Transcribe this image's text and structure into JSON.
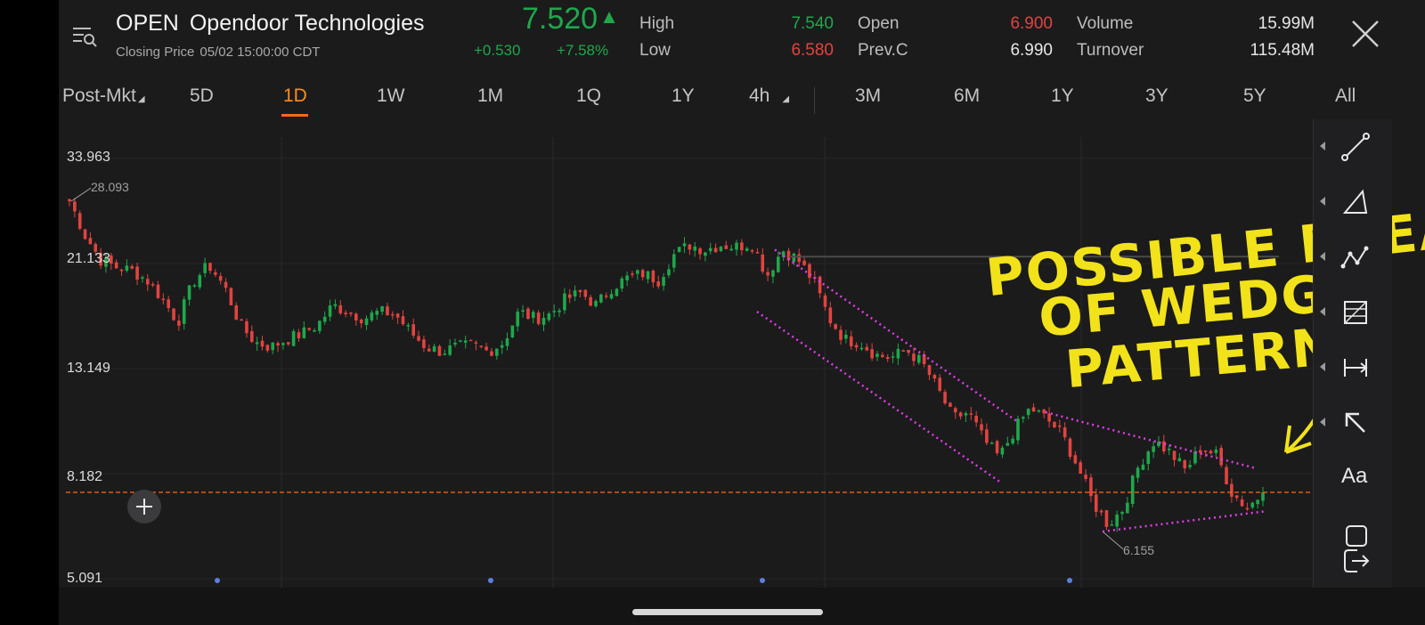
{
  "header": {
    "ticker": "OPEN",
    "company": "Opendoor Technologies",
    "status": "Closing Price",
    "timestamp": "05/02 15:00:00 CDT",
    "price": "7.520",
    "change": "+0.530",
    "change_pct": "+7.58%",
    "quote": {
      "high_label": "High",
      "high": "7.540",
      "low_label": "Low",
      "low": "6.580",
      "open_label": "Open",
      "open": "6.900",
      "prevc_label": "Prev.C",
      "prevc": "6.990",
      "volume_label": "Volume",
      "volume": "15.99M",
      "turnover_label": "Turnover",
      "turnover": "115.48M"
    },
    "colors": {
      "up": "#1ea84a",
      "down": "#e2433f",
      "accent": "#ff6a13"
    },
    "icons": [
      "menu-search-icon",
      "close-icon",
      "up-arrow-icon"
    ]
  },
  "tabs": [
    {
      "label": "Post-Mkt",
      "has_menu": true
    },
    {
      "label": "5D"
    },
    {
      "label": "1D",
      "active": true
    },
    {
      "label": "1W"
    },
    {
      "label": "1M"
    },
    {
      "label": "1Q"
    },
    {
      "label": "1Y"
    },
    {
      "label": "4h",
      "has_menu": true
    },
    {
      "label": "3M"
    },
    {
      "label": "6M"
    },
    {
      "label": "1Y"
    },
    {
      "label": "3Y"
    },
    {
      "label": "5Y"
    },
    {
      "label": "All"
    }
  ],
  "chart": {
    "y_labels": [
      "33.963",
      "21.133",
      "13.149",
      "8.182",
      "5.091"
    ],
    "scale": "log",
    "max_label": "28.093",
    "min_label": "6.155",
    "current_price_line": "7.520",
    "annotation": [
      "POSSIBLE BREAK",
      "OF WEDGE",
      "PATTERN"
    ],
    "annotation_color": "#f2e21a",
    "trendline_color": "#e23ce6"
  },
  "chart_data": {
    "type": "candlestick",
    "title": "",
    "y_scale": "log",
    "ylim": [
      5.091,
      33.963
    ],
    "y_ticks": [
      33.963,
      21.133,
      13.149,
      8.182,
      5.091
    ],
    "series": [
      {
        "values": [
          28.0,
          24.0,
          21.5,
          20.8,
          20.5,
          19.6,
          18.0,
          16.2,
          19.5,
          21.0,
          19.0,
          16.0,
          14.8,
          14.5,
          15.0,
          15.4,
          16.0,
          17.5,
          17.0,
          16.5,
          17.0,
          16.8,
          15.5,
          14.5,
          14.2,
          14.5,
          14.6,
          14.2,
          14.8,
          17.0,
          16.5,
          16.8,
          18.0,
          18.5,
          17.5,
          19.0,
          19.8,
          20.2,
          19.6,
          22.0,
          23.0,
          22.5,
          23.0,
          22.8,
          23.2,
          20.0,
          22.5,
          21.5,
          19.5,
          16.5,
          15.0,
          14.8,
          14.0,
          13.8,
          14.3,
          13.5,
          12.0,
          10.5,
          10.8,
          9.5,
          8.8,
          10.0,
          11.0,
          10.5,
          9.8,
          8.5,
          7.2,
          6.5,
          7.0,
          8.5,
          9.5,
          9.0,
          8.3,
          9.2,
          8.9,
          7.5,
          7.0,
          7.52
        ]
      }
    ],
    "annotations": [
      "28.093",
      "6.155"
    ]
  }
}
